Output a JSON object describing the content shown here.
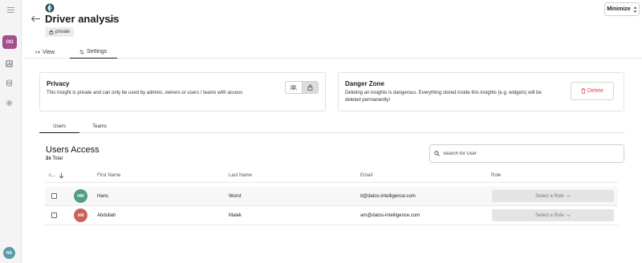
{
  "header": {
    "title": "Driver analysis",
    "visibility_badge": "private",
    "minimize_label": "Minimize"
  },
  "rail": {
    "workspace_initials": "OO",
    "user_initials": "NS",
    "workspace_color": "#a44d8f",
    "user_color": "#5b9aa8"
  },
  "tabs": [
    {
      "label": "View",
      "icon": "view-icon"
    },
    {
      "label": "Settings",
      "icon": "settings-sliders-icon",
      "active": true
    }
  ],
  "privacy": {
    "title": "Privacy",
    "description": "This Insight is private and can only be used by admins, owners or users / teams with access",
    "options": [
      "users-icon",
      "lock-icon"
    ],
    "selected": "lock-icon"
  },
  "danger": {
    "title": "Danger Zone",
    "description_line1": "Deleting an insights is dangerous. Everything stored inside this insights (e.g. widgets) will be",
    "description_line2": "deleted permanently!",
    "delete_label": "Delete",
    "delete_color": "#e0464c"
  },
  "subtabs": [
    {
      "label": "Users",
      "active": true
    },
    {
      "label": "Teams"
    }
  ],
  "users_access": {
    "title": "Users Access",
    "total_count": "2x",
    "total_label": "Total",
    "search_placeholder": "Search for User"
  },
  "table": {
    "columns": [
      "c...",
      "First Name",
      "Last Name",
      "Email",
      "Role"
    ],
    "rows": [
      {
        "initials": "HW",
        "avatar_color": "#4f9f86",
        "first": "Hans",
        "last": "Wurst",
        "email": "it@datos-intelligence.com",
        "role": "Select a Role"
      },
      {
        "initials": "AM",
        "avatar_color": "#c9625a",
        "first": "Abdullah",
        "last": "Malek",
        "email": "am@datos-intelligence.com",
        "role": "Select a Role"
      }
    ]
  }
}
